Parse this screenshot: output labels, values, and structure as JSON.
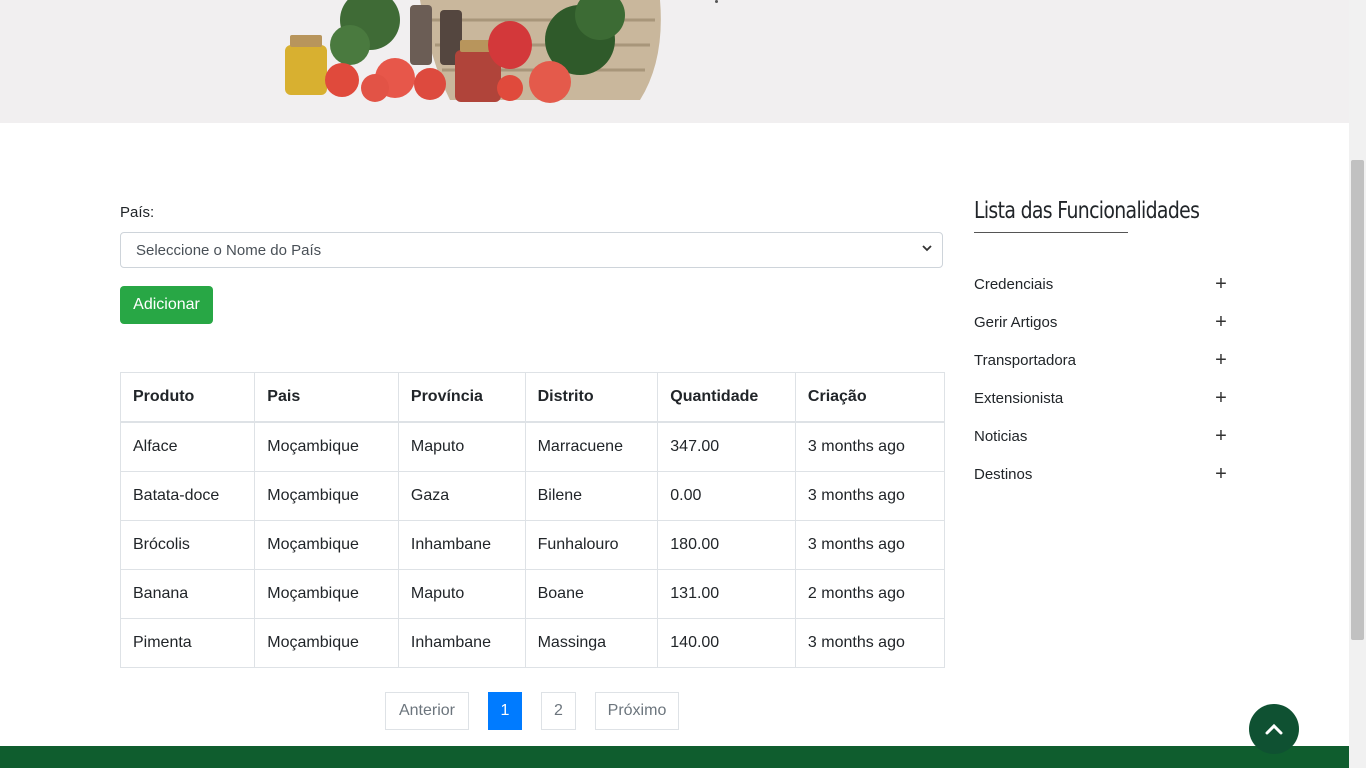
{
  "form": {
    "country_label": "País:",
    "country_select_value": "Seleccione o Nome do País",
    "add_button": "Adicionar"
  },
  "table": {
    "headers": [
      "Produto",
      "Pais",
      "Província",
      "Distrito",
      "Quantidade",
      "Criação"
    ],
    "rows": [
      [
        "Alface",
        "Moçambique",
        "Maputo",
        "Marracuene",
        "347.00",
        "3 months ago"
      ],
      [
        "Batata-doce",
        "Moçambique",
        "Gaza",
        "Bilene",
        "0.00",
        "3 months ago"
      ],
      [
        "Brócolis",
        "Moçambique",
        "Inhambane",
        "Funhalouro",
        "180.00",
        "3 months ago"
      ],
      [
        "Banana",
        "Moçambique",
        "Maputo",
        "Boane",
        "131.00",
        "2 months ago"
      ],
      [
        "Pimenta",
        "Moçambique",
        "Inhambane",
        "Massinga",
        "140.00",
        "3 months ago"
      ]
    ]
  },
  "pagination": {
    "prev": "Anterior",
    "pages": [
      "1",
      "2"
    ],
    "active_page": "1",
    "next": "Próximo"
  },
  "sidebar": {
    "title": "Lista das Funcionalidades",
    "items": [
      {
        "label": "Credenciais",
        "icon": "plus-icon"
      },
      {
        "label": "Gerir Artigos",
        "icon": "plus-icon"
      },
      {
        "label": "Transportadora",
        "icon": "plus-icon"
      },
      {
        "label": "Extensionista",
        "icon": "plus-icon"
      },
      {
        "label": "Noticias",
        "icon": "plus-icon"
      },
      {
        "label": "Destinos",
        "icon": "plus-icon"
      }
    ]
  },
  "colors": {
    "primary_green": "#28a745",
    "footer_green": "#0f5d2e",
    "active_page_blue": "#007bff"
  }
}
